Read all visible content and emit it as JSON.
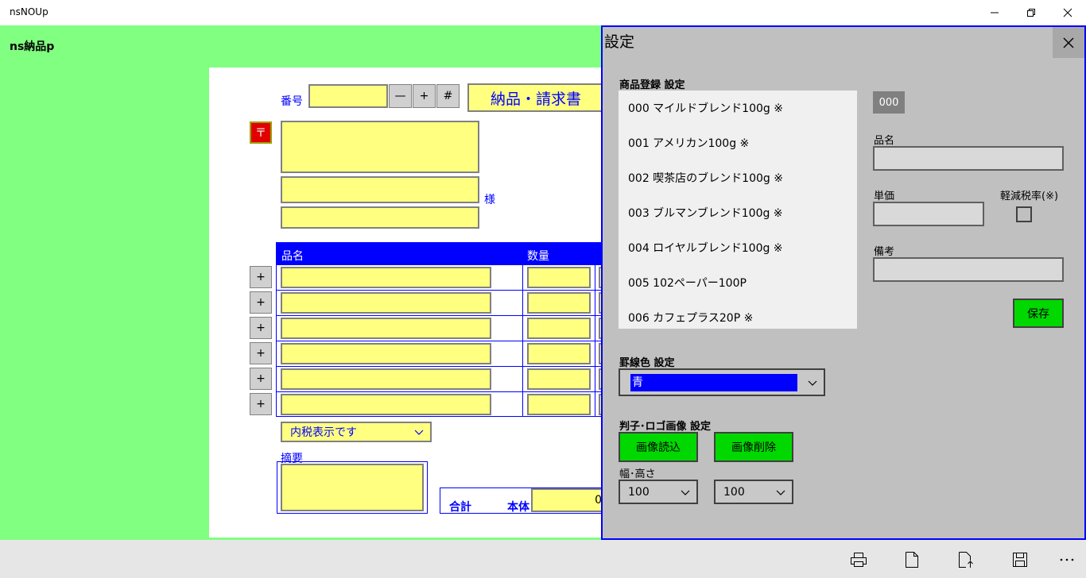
{
  "window": {
    "title": "nsNOUp"
  },
  "app": {
    "name": "ns納品p"
  },
  "doc": {
    "number_label": "番号",
    "btn_minus": "—",
    "btn_plus": "+",
    "btn_hash": "#",
    "doc_title": "納品・請求書",
    "postal_mark": "〒",
    "honorific": "様",
    "col_item": "品名",
    "col_qty": "数量",
    "row_add": "+",
    "tax_select": "内税表示です",
    "memo_label": "摘要",
    "total_label": "合計",
    "base_label": "本体",
    "total_value_partial": "0"
  },
  "settings": {
    "title": "設定",
    "products_header": "商品登録 設定",
    "products": [
      "000 マイルドブレンド100g ※",
      "001 アメリカン100g ※",
      "002 喫茶店のブレンド100g ※",
      "003 ブルマンブレンド100g ※",
      "004 ロイヤルブレンド100g ※",
      "005 102ペーパー100P",
      "006 カフェプラス20P ※"
    ],
    "code": "000",
    "name_label": "品名",
    "price_label": "単価",
    "reduced_tax_label": "軽減税率(※)",
    "note_label": "備考",
    "save_label": "保存",
    "line_color_header": "罫線色 設定",
    "line_color_value": "青",
    "stamp_header": "判子･ロゴ画像 設定",
    "load_image": "画像読込",
    "delete_image": "画像削除",
    "size_label": "幅･高さ",
    "width_value": "100",
    "height_value": "100"
  },
  "colors": {
    "app_bg": "#80ff80",
    "field": "#ffff80",
    "accent_blue": "#0000ff",
    "settings_bg": "#c0c0c0",
    "green_btn": "#00d800"
  }
}
